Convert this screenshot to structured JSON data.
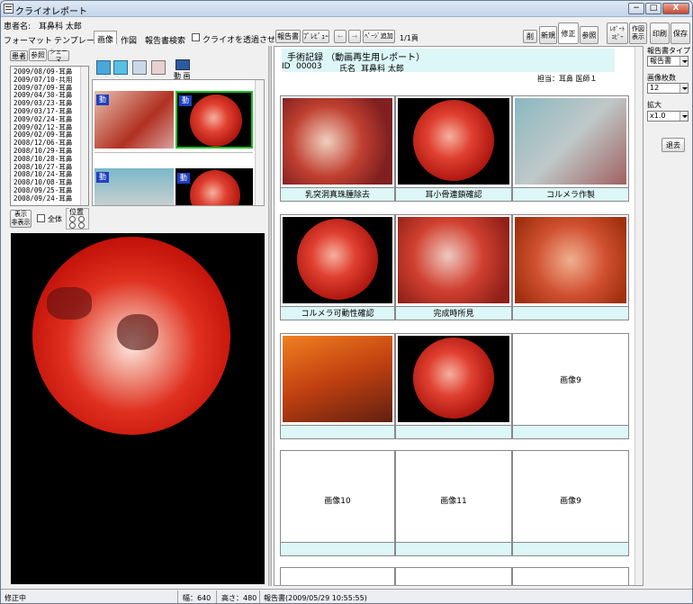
{
  "window": {
    "title": "クライオレポート",
    "min": "−",
    "max": "□",
    "close": "X"
  },
  "patient": {
    "label": "患者名:",
    "name": "耳鼻科 太郎"
  },
  "tabs": {
    "format": "フォーマット",
    "template": "テンプレート",
    "image": "画像",
    "figure": "作図",
    "search": "報告書検索",
    "transparent": "クライオを透過させる"
  },
  "left": {
    "tab_patient": "患者",
    "tab_ref": "参照",
    "tab_schema": "シェーマ",
    "movie": "動 画",
    "display_btn": "表示\n非表示",
    "all_label": "全体",
    "pos_label": "位置"
  },
  "dates": [
    "2009/08/09-耳鼻",
    "2009/07/10-共用",
    "2009/07/09-耳鼻",
    "2009/04/30-耳鼻",
    "2009/03/23-耳鼻",
    "2009/03/17-耳鼻",
    "2009/02/24-耳鼻",
    "2009/02/12-耳鼻",
    "2009/02/09-耳鼻",
    "2008/12/06-耳鼻",
    "2008/10/29-耳鼻",
    "2008/10/28-耳鼻",
    "2008/10/27-耳鼻",
    "2008/10/24-耳鼻",
    "2008/10/08-耳鼻",
    "2008/09/25-耳鼻",
    "2008/09/24-耳鼻"
  ],
  "thumbs": {
    "badge": "動"
  },
  "toolbar": {
    "report": "報告書",
    "preview": "ﾌﾟﾚﾋﾞｭｰ",
    "back": "←",
    "fwd": "→",
    "addpage": "ﾍﾟｰｼﾞ追加",
    "pages": "1/1頁",
    "delete": "削",
    "new": "新規",
    "edit": "修正",
    "ref": "参照",
    "copy": "ﾚﾎﾟｰﾄ\nｺﾋﾟｰ",
    "drawdisp": "作図\n表示",
    "print": "印刷",
    "save": "保存"
  },
  "report": {
    "title": "手術記録 （動画再生用レポート）",
    "id_label": "ID",
    "id": "00003",
    "name_label": "氏名",
    "name": "耳鼻科 太郎",
    "staff": "担当：耳鼻 医師１",
    "row1": [
      "乳突洞真珠腫除去",
      "耳小骨連鎖確認",
      "コルメラ作製"
    ],
    "row2": [
      "コルメラ可動性確認",
      "完成時所見",
      ""
    ],
    "row3_ph": [
      "",
      "",
      "画像9"
    ],
    "row4_ph": [
      "画像10",
      "画像11",
      "画像9"
    ]
  },
  "right": {
    "type_label": "報告書タイプ",
    "type_val": "報告書",
    "count_label": "画像枚数",
    "count_val": "12",
    "zoom_label": "拡大",
    "zoom_val": "x1.0",
    "leave": "退去"
  },
  "status": {
    "mode": "修正中",
    "width": "幅：640",
    "height": "高さ：480",
    "report": "報告書(2009/05/29 10:55:55)"
  }
}
